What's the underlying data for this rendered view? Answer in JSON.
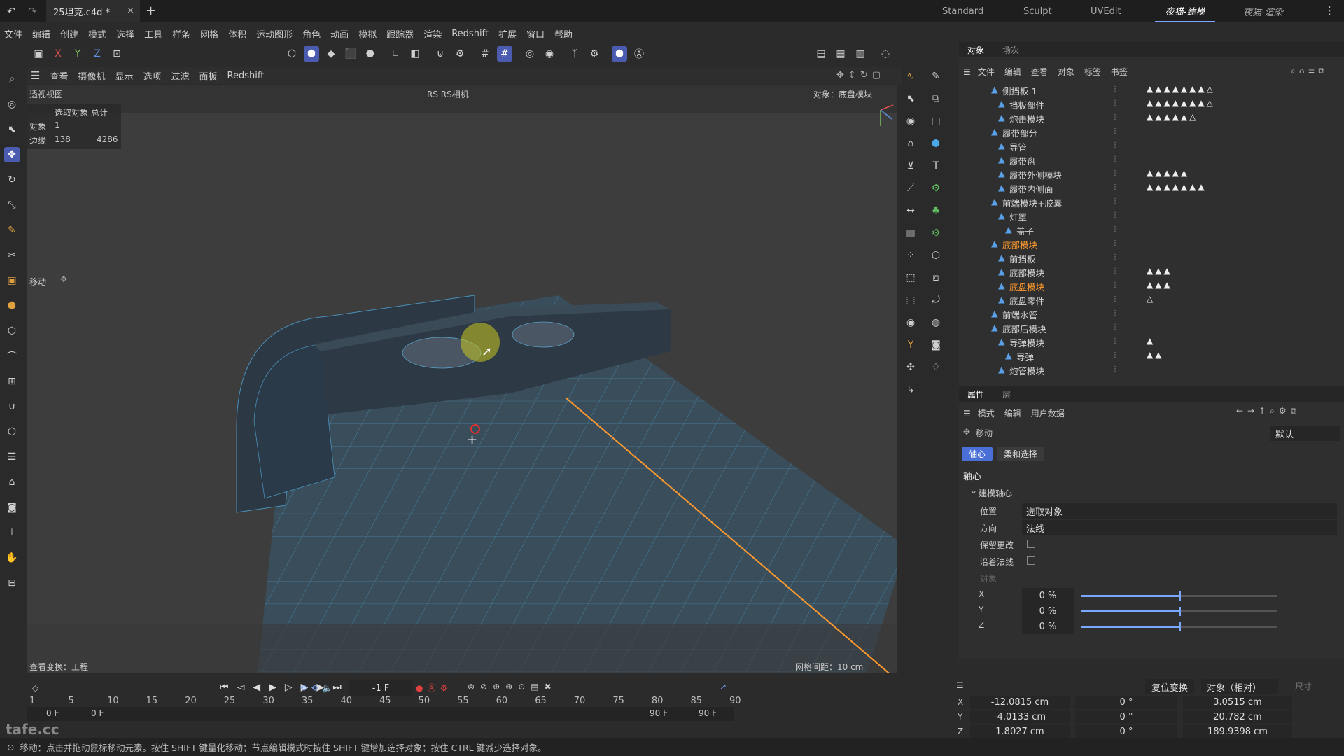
{
  "titlebar": {
    "doc_tab": "25坦克.c4d *",
    "close": "×",
    "plus": "+",
    "layouts": [
      "Standard",
      "Sculpt",
      "UVEdit",
      "夜猫-建模",
      "夜猫-渲染"
    ],
    "active_layout": "夜猫-建模"
  },
  "menubar": [
    "文件",
    "编辑",
    "创建",
    "模式",
    "选择",
    "工具",
    "样条",
    "网格",
    "体积",
    "运动图形",
    "角色",
    "动画",
    "模拟",
    "跟踪器",
    "渲染",
    "Redshift",
    "扩展",
    "窗口",
    "帮助"
  ],
  "axis_toggles": [
    "X",
    "Y",
    "Z"
  ],
  "viewport_menu": [
    "查看",
    "摄像机",
    "显示",
    "选项",
    "过滤",
    "面板",
    "Redshift"
  ],
  "viewport": {
    "view_name": "透视视图",
    "camera": "RS RS相机",
    "object_label": "对象：底盘模块",
    "stats_header": "选取对象  总计",
    "stats_object_label": "对象",
    "stats_object_value": "1",
    "stats_edge_label": "边缘",
    "stats_edge_sel": "138",
    "stats_edge_total": "4286",
    "move_label": "移动",
    "view_transform": "查看变换：工程",
    "grid_spacing": "网格间距：10 cm",
    "colors": {
      "bg": "#3d3d3d",
      "mesh": "#2e3a46",
      "wire": "#4a90b8",
      "edge_highlight": "#ff9a2e"
    }
  },
  "objpanel": {
    "tabs": [
      "对象",
      "场次"
    ],
    "menu": [
      "文件",
      "编辑",
      "查看",
      "对象",
      "标签",
      "书签"
    ],
    "rows": [
      {
        "label": "侧挡板.1",
        "indent": 3,
        "tags": "▲▲▲▲▲▲▲△"
      },
      {
        "label": "挡板部件",
        "indent": 4,
        "tags": "▲▲▲▲▲▲▲△"
      },
      {
        "label": "炮击模块",
        "indent": 4,
        "tags": "▲▲▲▲▲△"
      },
      {
        "label": "履带部分",
        "indent": 3,
        "tags": ""
      },
      {
        "label": "导管",
        "indent": 4,
        "tags": ""
      },
      {
        "label": "履带盘",
        "indent": 4,
        "tags": ""
      },
      {
        "label": "履带外侧模块",
        "indent": 4,
        "tags": "▲▲▲▲▲"
      },
      {
        "label": "履带内侧面",
        "indent": 4,
        "tags": "▲▲▲▲▲▲▲"
      },
      {
        "label": "前端模块+胶囊",
        "indent": 3,
        "tags": ""
      },
      {
        "label": "灯罩",
        "indent": 4,
        "tags": ""
      },
      {
        "label": "盖子",
        "indent": 5,
        "tags": ""
      },
      {
        "label": "底部模块",
        "indent": 3,
        "tags": "",
        "selected": true
      },
      {
        "label": "前挡板",
        "indent": 4,
        "tags": ""
      },
      {
        "label": "底部模块",
        "indent": 4,
        "tags": "▲▲▲"
      },
      {
        "label": "底盘模块",
        "indent": 4,
        "tags": "▲▲▲",
        "selected": true
      },
      {
        "label": "底盘零件",
        "indent": 4,
        "tags": "△"
      },
      {
        "label": "前端水管",
        "indent": 3,
        "tags": ""
      },
      {
        "label": "底部后模块",
        "indent": 3,
        "tags": ""
      },
      {
        "label": "导弹模块",
        "indent": 4,
        "tags": "▲"
      },
      {
        "label": "导弹",
        "indent": 5,
        "tags": "▲▲"
      },
      {
        "label": "炮管模块",
        "indent": 4,
        "tags": ""
      }
    ]
  },
  "attrpanel": {
    "tabs": [
      "属性",
      "层"
    ],
    "menu": [
      "模式",
      "编辑",
      "用户数据"
    ],
    "tool_name": "移动",
    "preset": "默认",
    "subtabs": [
      "轴心",
      "柔和选择"
    ],
    "section": "轴心",
    "group": "建模轴心",
    "position_label": "位置",
    "position_value": "选取对象",
    "direction_label": "方向",
    "direction_value": "法线",
    "keep_changes": "保留更改",
    "along_normal": "沿着法线",
    "object_label": "对象",
    "axes": [
      {
        "label": "X",
        "value": "0 %",
        "level": 0.5
      },
      {
        "label": "Y",
        "value": "0 %",
        "level": 0.5
      },
      {
        "label": "Z",
        "value": "0 %",
        "level": 0.5
      }
    ]
  },
  "coords": {
    "reset_button": "复位变换",
    "mode": "对象（相对）",
    "size_label": "尺寸",
    "rows": [
      {
        "axis": "X",
        "pos": "-12.0815 cm",
        "rot": "0 °",
        "size": "3.0515 cm"
      },
      {
        "axis": "Y",
        "pos": "-4.0133 cm",
        "rot": "0 °",
        "size": "20.782 cm"
      },
      {
        "axis": "Z",
        "pos": "1.8027 cm",
        "rot": "0 °",
        "size": "189.9398 cm"
      }
    ]
  },
  "timeline": {
    "current_frame": "-1 F",
    "ruler": [
      "1",
      "5",
      "10",
      "15",
      "20",
      "25",
      "30",
      "35",
      "40",
      "45",
      "50",
      "55",
      "60",
      "65",
      "70",
      "75",
      "80",
      "85",
      "90"
    ],
    "start_frame": "0 F",
    "start_frame2": "0 F",
    "end_frame": "90 F",
    "end_frame2": "90 F"
  },
  "watermark": "tafe.cc",
  "status": "移动：点击并拖动鼠标移动元素。按住 SHIFT 键量化移动；节点编辑模式时按住 SHIFT 键增加选择对象；按住 CTRL 键减少选择对象。"
}
